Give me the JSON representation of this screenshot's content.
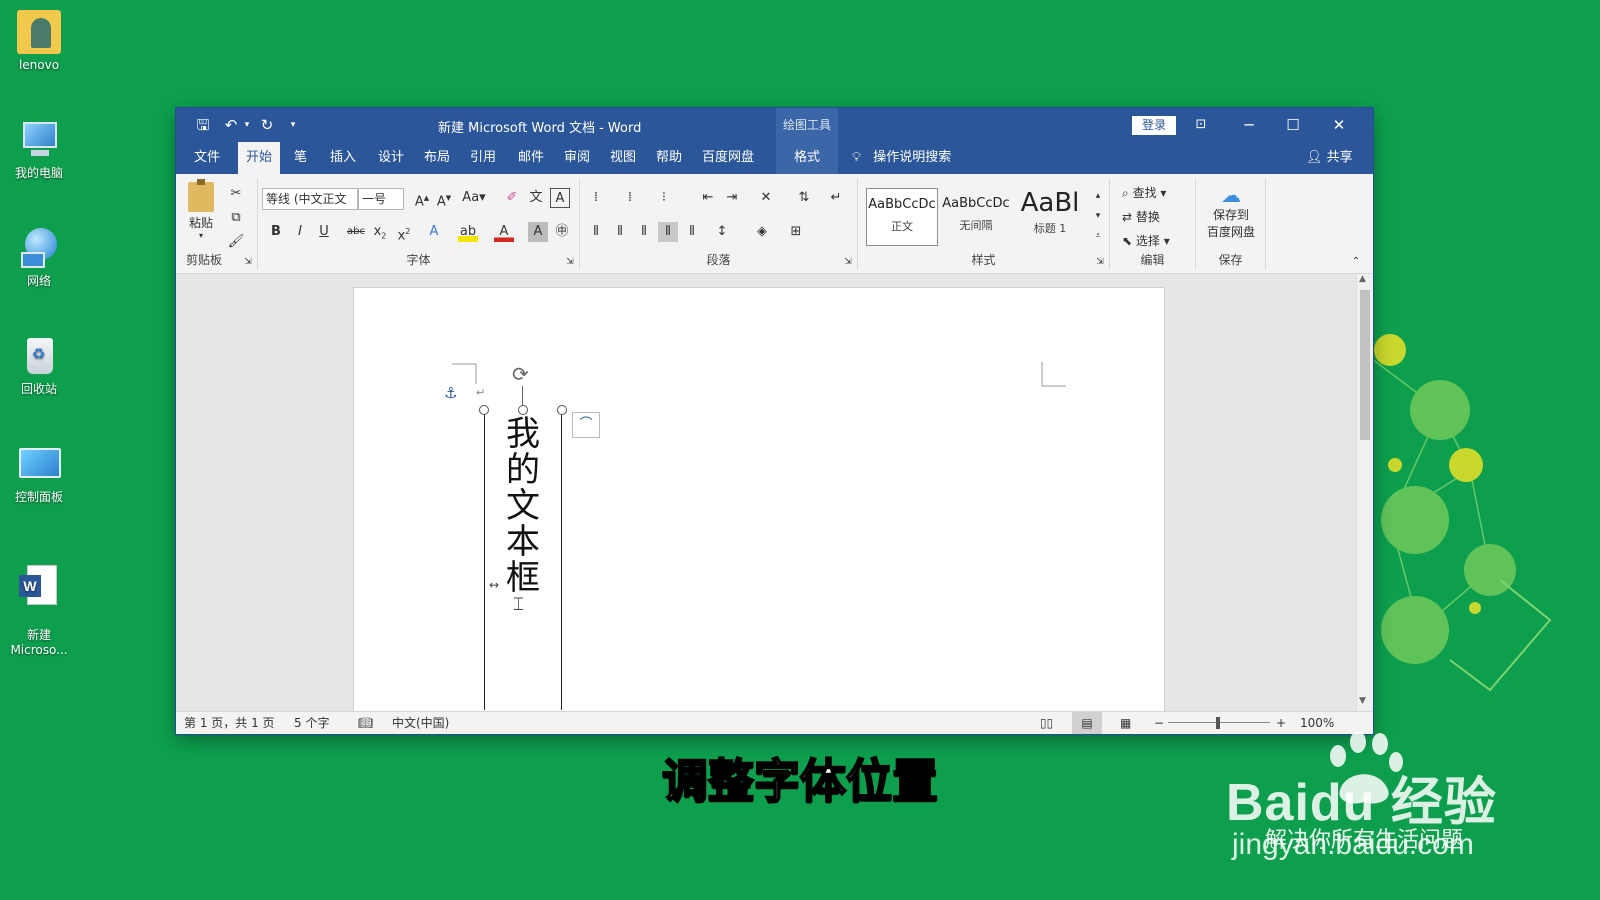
{
  "desktop": {
    "icons": [
      {
        "label": "lenovo"
      },
      {
        "label": "我的电脑"
      },
      {
        "label": "网络"
      },
      {
        "label": "回收站"
      },
      {
        "label": "控制面板"
      },
      {
        "label": "新建\nMicroso..."
      }
    ]
  },
  "window": {
    "title": "新建 Microsoft Word 文档  -  Word",
    "context_tools_label": "绘图工具",
    "login_label": "登录"
  },
  "tabs": [
    "文件",
    "开始",
    "笔",
    "插入",
    "设计",
    "布局",
    "引用",
    "邮件",
    "审阅",
    "视图",
    "帮助",
    "百度网盘",
    "格式"
  ],
  "tell_me": "操作说明搜索",
  "share": "共享",
  "ribbon": {
    "clipboard": {
      "paste": "粘贴",
      "label": "剪贴板"
    },
    "font": {
      "font_name": "等线 (中文正文",
      "font_size": "一号",
      "label": "字体"
    },
    "paragraph": {
      "label": "段落"
    },
    "styles": {
      "label": "样式",
      "items": [
        {
          "sample": "AaBbCcDc",
          "name": "正文"
        },
        {
          "sample": "AaBbCcDc",
          "name": "无间隔"
        },
        {
          "sample": "AaBl",
          "name": "标题 1"
        }
      ]
    },
    "editing": {
      "find": "查找",
      "replace": "替换",
      "select": "选择",
      "label": "编辑"
    },
    "save": {
      "line1": "保存到",
      "line2": "百度网盘",
      "label": "保存"
    }
  },
  "document": {
    "textbox_text": "我的文本框"
  },
  "status": {
    "page": "第 1 页，共 1 页",
    "words": "5 个字",
    "language": "中文(中国)",
    "zoom": "100%"
  },
  "caption": "调整字体位置",
  "watermark": {
    "brand": "Baidu 经验",
    "url": "jingyan.baidu.com",
    "slogan": "解决你所有生活问题"
  },
  "colors": {
    "desktop_bg": "#0d9f4e",
    "word_blue": "#2b579a"
  }
}
